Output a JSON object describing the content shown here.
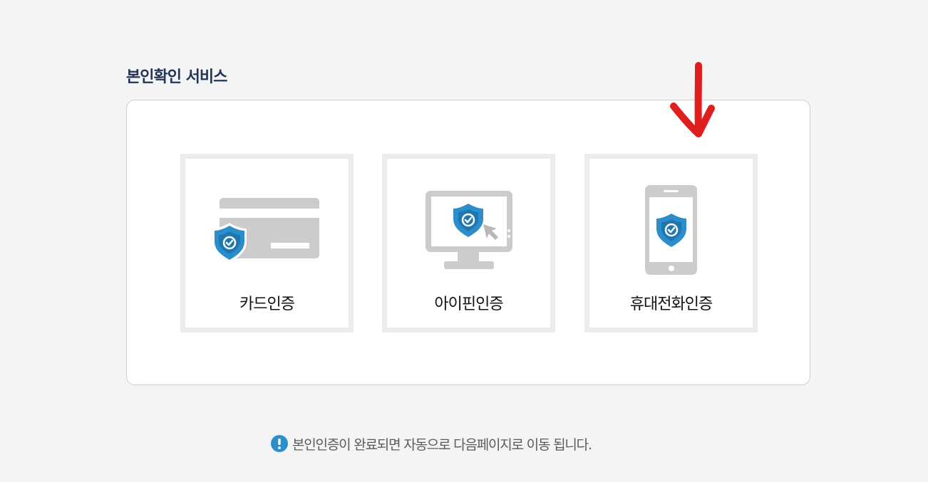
{
  "title": "본인확인 서비스",
  "options": [
    {
      "label": "카드인증",
      "icon": "credit-card-shield-icon"
    },
    {
      "label": "아이핀인증",
      "icon": "monitor-shield-icon"
    },
    {
      "label": "휴대전화인증",
      "icon": "mobile-phone-shield-icon"
    }
  ],
  "notice": {
    "icon": "exclamation-info-icon",
    "text": "본인인증이 완료되면 자동으로 다음페이지로 이동 됩니다."
  },
  "colors": {
    "shield": "#2b8ecb",
    "icon_gray": "#cccccc",
    "arrow": "#e01e1e",
    "title": "#22345a"
  }
}
